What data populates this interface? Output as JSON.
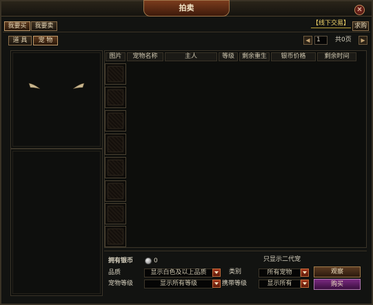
{
  "window": {
    "title": "拍卖",
    "close_icon": "close-icon"
  },
  "top_tabs": [
    {
      "label": "我要买"
    },
    {
      "label": "我要卖"
    }
  ],
  "header_actions": {
    "offline_trade": "【线下交易】",
    "request_buy": "求购"
  },
  "category_tabs": [
    {
      "label": "道 具"
    },
    {
      "label": "宠 物"
    }
  ],
  "pager": {
    "current_page": "1",
    "total_label": "共0页"
  },
  "table": {
    "columns": [
      "图片",
      "宠物名称",
      "主人",
      "等级",
      "剩余重生",
      "银币价格",
      "剩余时间"
    ],
    "rows": []
  },
  "filters": {
    "silver_label": "拥有银币",
    "silver_value": "0",
    "only_gen2": "只显示二代宠",
    "quality_label": "品质",
    "quality_value": "显示白色及以上品质",
    "category_label": "类别",
    "category_value": "所有宠物",
    "pet_level_label": "宠物等级",
    "pet_level_value": "显示所有等级",
    "carry_level_label": "携带等级",
    "carry_level_value": "显示所有"
  },
  "buttons": {
    "observe": "观察",
    "buy": "购买"
  },
  "colors": {
    "accent_red": "#a3361c",
    "buy_purple": "#6a1e6e",
    "gold_text": "#f0d36a"
  }
}
